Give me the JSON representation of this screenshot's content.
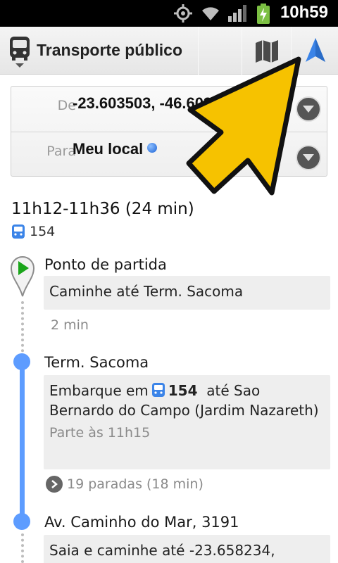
{
  "status_bar": {
    "time": "10h59"
  },
  "action_bar": {
    "title": "Transporte público"
  },
  "route": {
    "from_label": "De",
    "from_value": "-23.603503, -46.603787",
    "to_label": "Para",
    "to_value": "Meu local"
  },
  "summary": {
    "time_range": "11h12-11h36 (24 min)",
    "bus_line": "154"
  },
  "steps": [
    {
      "title": "Ponto de partida",
      "instruction": "Caminhe até Term. Sacoma",
      "duration": "2 min"
    },
    {
      "title": "Term. Sacoma",
      "board_prefix": "Embarque em",
      "bus_line": "154",
      "board_suffix": "até Sao Bernardo do Campo (Jardim Nazareth)",
      "departure": "Parte às 11h15",
      "stops": "19 paradas (18 min)"
    },
    {
      "title": "Av. Caminho do Mar, 3191",
      "instruction": "Saia e caminhe até -23.658234,"
    }
  ],
  "colors": {
    "route_line": "#5d9cff",
    "annotation_arrow": "#f6c200",
    "nav_arrow": "#3b84e8"
  }
}
